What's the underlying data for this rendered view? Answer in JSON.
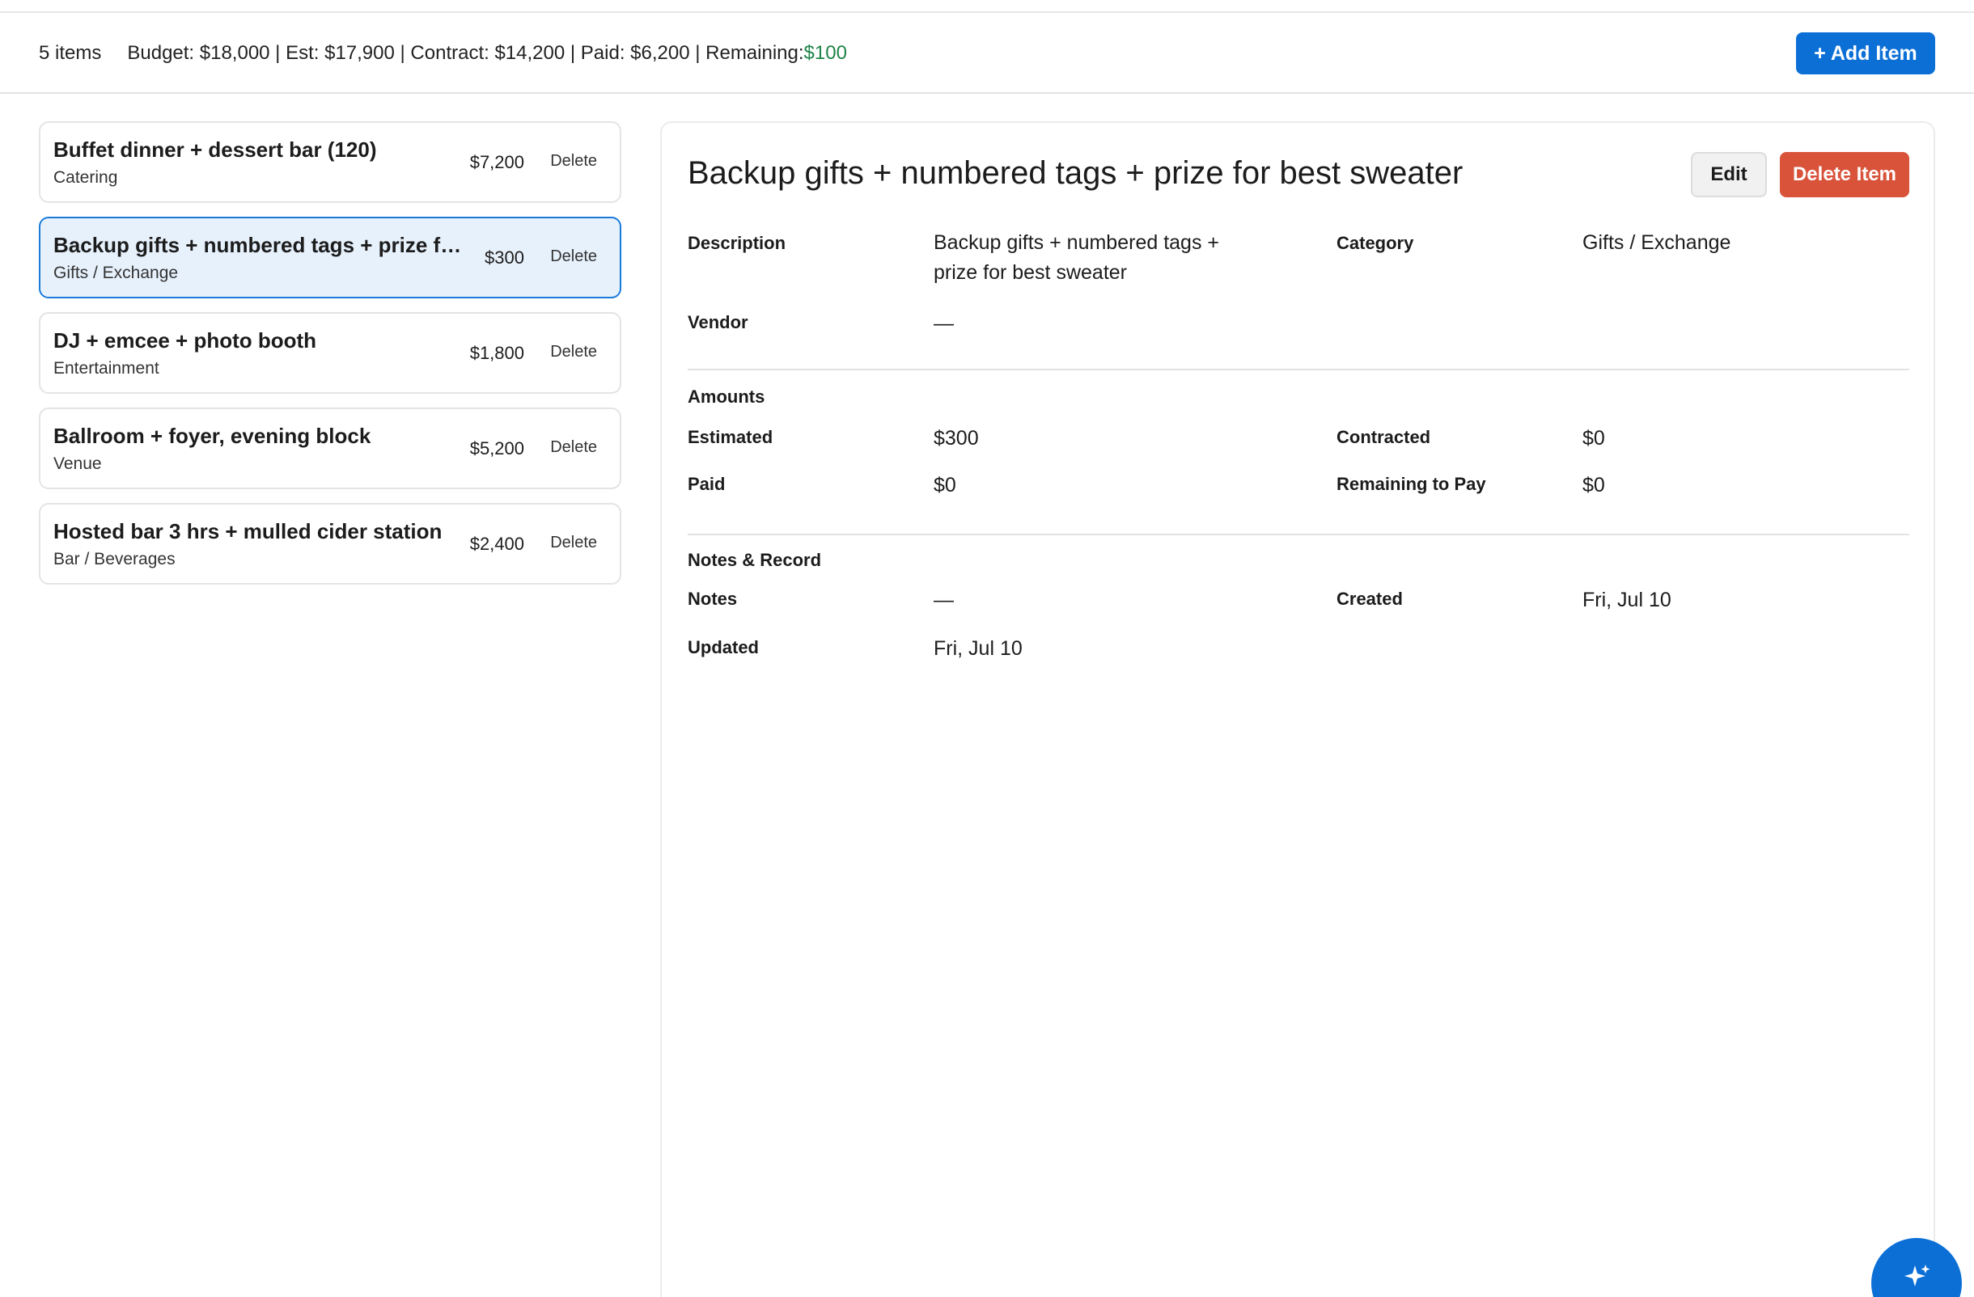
{
  "summary": {
    "item_count": "5 items",
    "totals_text": "Budget: $18,000 | Est: $17,900 | Contract: $14,200 | Paid: $6,200 | Remaining: ",
    "remaining_value": "$100",
    "add_item_label": "+ Add Item"
  },
  "items": [
    {
      "title": "Buffet dinner + dessert bar (120)",
      "category": "Catering",
      "amount": "$7,200",
      "delete_label": "Delete",
      "selected": false
    },
    {
      "title": "Backup gifts + numbered tags + prize for best sweater",
      "category": "Gifts / Exchange",
      "amount": "$300",
      "delete_label": "Delete",
      "selected": true
    },
    {
      "title": "DJ + emcee + photo booth",
      "category": "Entertainment",
      "amount": "$1,800",
      "delete_label": "Delete",
      "selected": false
    },
    {
      "title": "Ballroom + foyer, evening block",
      "category": "Venue",
      "amount": "$5,200",
      "delete_label": "Delete",
      "selected": false
    },
    {
      "title": "Hosted bar 3 hrs + mulled cider station",
      "category": "Bar / Beverages",
      "amount": "$2,400",
      "delete_label": "Delete",
      "selected": false
    }
  ],
  "detail": {
    "title": "Backup gifts + numbered tags + prize for best sweater",
    "edit_label": "Edit",
    "delete_label": "Delete Item",
    "description_label": "Description",
    "description_line1": "Backup gifts + numbered tags +",
    "description_line2": "prize for best sweater",
    "category_label": "Category",
    "category_value": "Gifts / Exchange",
    "vendor_label": "Vendor",
    "vendor_value": "—",
    "amounts_section": "Amounts",
    "estimated_label": "Estimated",
    "estimated_value": "$300",
    "contracted_label": "Contracted",
    "contracted_value": "$0",
    "paid_label": "Paid",
    "paid_value": "$0",
    "remaining_label": "Remaining to Pay",
    "remaining_value": "$0",
    "notes_section": "Notes & Record",
    "notes_label": "Notes",
    "notes_value": "—",
    "created_label": "Created",
    "created_value": "Fri, Jul 10",
    "updated_label": "Updated",
    "updated_value": "Fri, Jul 10"
  },
  "fab": {
    "icon": "sparkle-icon"
  },
  "colors": {
    "accent": "#0b6fd6",
    "danger": "#d9533b",
    "positive": "#1e8449",
    "selected_bg": "#e7f1fc"
  }
}
